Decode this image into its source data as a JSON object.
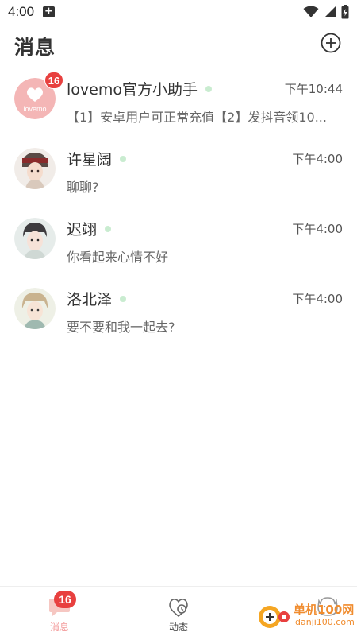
{
  "status_bar": {
    "time": "4:00",
    "notification_glyph": "+"
  },
  "header": {
    "title": "消息",
    "add_icon": "plus-circle-icon"
  },
  "conversations": [
    {
      "name": "lovemo官方小助手",
      "time": "下午10:44",
      "preview": "【1】安卓用户可正常充值【2】发抖音领10...",
      "badge": "16",
      "avatar_text": "lovemo",
      "online": true
    },
    {
      "name": "许星阔",
      "time": "下午4:00",
      "preview": "聊聊?",
      "online": true
    },
    {
      "name": "迟翊",
      "time": "下午4:00",
      "preview": "你看起来心情不好",
      "online": true
    },
    {
      "name": "洛北泽",
      "time": "下午4:00",
      "preview": "要不要和我一起去?",
      "online": true
    }
  ],
  "tab_bar": {
    "tabs": [
      {
        "label": "消息",
        "badge": "16",
        "icon": "message-bubble-icon",
        "active": true
      },
      {
        "label": "动态",
        "icon": "moments-icon",
        "active": false
      },
      {
        "label": "",
        "icon": "profile-icon",
        "active": false
      }
    ]
  },
  "watermark": {
    "main": "单机100网",
    "sub": "danji100.com"
  },
  "colors": {
    "badge": "#e8403f",
    "online_dot": "#c9ecd0",
    "active_tab": "#f39a9a",
    "brand_pink": "#f4b6b6"
  }
}
